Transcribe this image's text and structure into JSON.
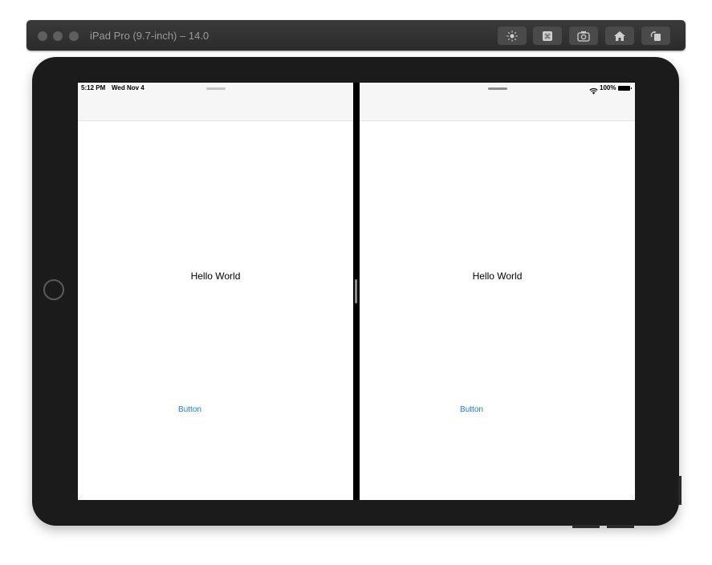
{
  "window": {
    "title": "iPad Pro (9.7-inch) – 14.0",
    "toolbar_icons": [
      "brightness-icon",
      "command-icon",
      "screenshot-icon",
      "home-icon",
      "rotate-icon"
    ]
  },
  "status_bar": {
    "time": "5:12 PM",
    "date": "Wed Nov 4",
    "battery": "100%"
  },
  "left_pane": {
    "label": "Hello World",
    "button_label": "Button"
  },
  "right_pane": {
    "label": "Hello World",
    "button_label": "Button"
  },
  "colors": {
    "accent": "#1a7ae8",
    "device_body": "#1b1b1b",
    "navbar": "#f6f6f6"
  }
}
